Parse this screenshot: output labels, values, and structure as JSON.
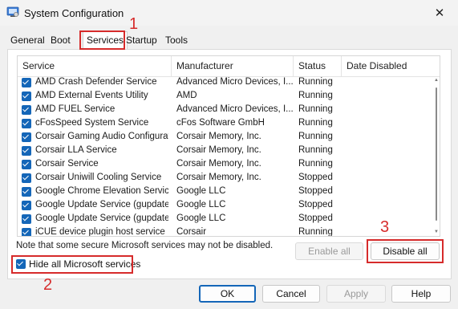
{
  "window": {
    "title": "System Configuration"
  },
  "tabs": [
    {
      "label": "General"
    },
    {
      "label": "Boot"
    },
    {
      "label": "Services"
    },
    {
      "label": "Startup"
    },
    {
      "label": "Tools"
    }
  ],
  "columns": [
    "Service",
    "Manufacturer",
    "Status",
    "Date Disabled"
  ],
  "services": [
    {
      "name": "AMD Crash Defender Service",
      "manufacturer": "Advanced Micro Devices, I...",
      "status": "Running"
    },
    {
      "name": "AMD External Events Utility",
      "manufacturer": "AMD",
      "status": "Running"
    },
    {
      "name": "AMD FUEL Service",
      "manufacturer": "Advanced Micro Devices, I...",
      "status": "Running"
    },
    {
      "name": "cFosSpeed System Service",
      "manufacturer": "cFos Software GmbH",
      "status": "Running"
    },
    {
      "name": "Corsair Gaming Audio Configurat...",
      "manufacturer": "Corsair Memory, Inc.",
      "status": "Running"
    },
    {
      "name": "Corsair LLA Service",
      "manufacturer": "Corsair Memory, Inc.",
      "status": "Running"
    },
    {
      "name": "Corsair Service",
      "manufacturer": "Corsair Memory, Inc.",
      "status": "Running"
    },
    {
      "name": "Corsair Uniwill Cooling Service",
      "manufacturer": "Corsair Memory, Inc.",
      "status": "Stopped"
    },
    {
      "name": "Google Chrome Elevation Servic...",
      "manufacturer": "Google LLC",
      "status": "Stopped"
    },
    {
      "name": "Google Update Service (gupdate)",
      "manufacturer": "Google LLC",
      "status": "Stopped"
    },
    {
      "name": "Google Update Service (gupdatem)",
      "manufacturer": "Google LLC",
      "status": "Stopped"
    },
    {
      "name": "iCUE device plugin host service",
      "manufacturer": "Corsair",
      "status": "Running"
    }
  ],
  "note": "Note that some secure Microsoft services may not be disabled.",
  "buttons": {
    "enable_all": "Enable all",
    "disable_all": "Disable all",
    "ok": "OK",
    "cancel": "Cancel",
    "apply": "Apply",
    "help": "Help"
  },
  "hide_ms": {
    "label": "Hide all Microsoft services",
    "checked": true
  },
  "annotations": [
    "1",
    "2",
    "3"
  ],
  "colors": {
    "accent": "#1466b8",
    "annotation": "#d62b2b"
  }
}
